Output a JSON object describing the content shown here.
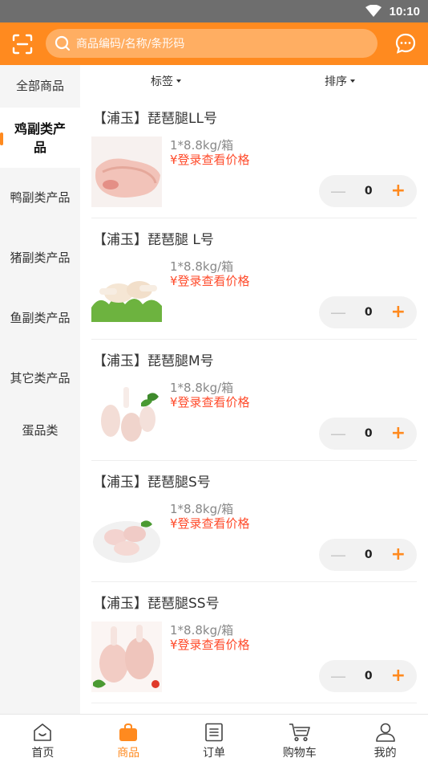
{
  "status_bar": {
    "time": "10:10"
  },
  "header": {
    "search_placeholder": "商品编码/名称/条形码",
    "scan_icon": "scan-icon",
    "message_icon": "chat-bubble-icon",
    "accent_color": "#ff8a1f"
  },
  "sidebar": {
    "items": [
      {
        "label": "全部商品",
        "active": false
      },
      {
        "label": "鸡副类产品",
        "active": true
      },
      {
        "label": "鸭副类产品",
        "active": false
      },
      {
        "label": "猪副类产品",
        "active": false
      },
      {
        "label": "鱼副类产品",
        "active": false
      },
      {
        "label": "其它类产品",
        "active": false
      },
      {
        "label": "蛋品类",
        "active": false
      }
    ]
  },
  "filters": {
    "tag_label": "标签",
    "sort_label": "排序"
  },
  "products": [
    {
      "title": "【浦玉】琵琶腿LL号",
      "spec": "1*8.8kg/箱",
      "price": "¥登录查看价格",
      "qty": "0"
    },
    {
      "title": "【浦玉】琵琶腿 L号",
      "spec": "1*8.8kg/箱",
      "price": "¥登录查看价格",
      "qty": "0"
    },
    {
      "title": "【浦玉】琵琶腿M号",
      "spec": "1*8.8kg/箱",
      "price": "¥登录查看价格",
      "qty": "0"
    },
    {
      "title": "【浦玉】琵琶腿S号",
      "spec": "1*8.8kg/箱",
      "price": "¥登录查看价格",
      "qty": "0"
    },
    {
      "title": "【浦玉】琵琶腿SS号",
      "spec": "1*8.8kg/箱",
      "price": "¥登录查看价格",
      "qty": "0"
    }
  ],
  "bottom_nav": {
    "items": [
      {
        "label": "首页",
        "icon": "home-icon",
        "active": false
      },
      {
        "label": "商品",
        "icon": "shopping-bag-icon",
        "active": true
      },
      {
        "label": "订单",
        "icon": "order-list-icon",
        "active": false
      },
      {
        "label": "购物车",
        "icon": "cart-icon",
        "active": false
      },
      {
        "label": "我的",
        "icon": "user-icon",
        "active": false
      }
    ]
  }
}
